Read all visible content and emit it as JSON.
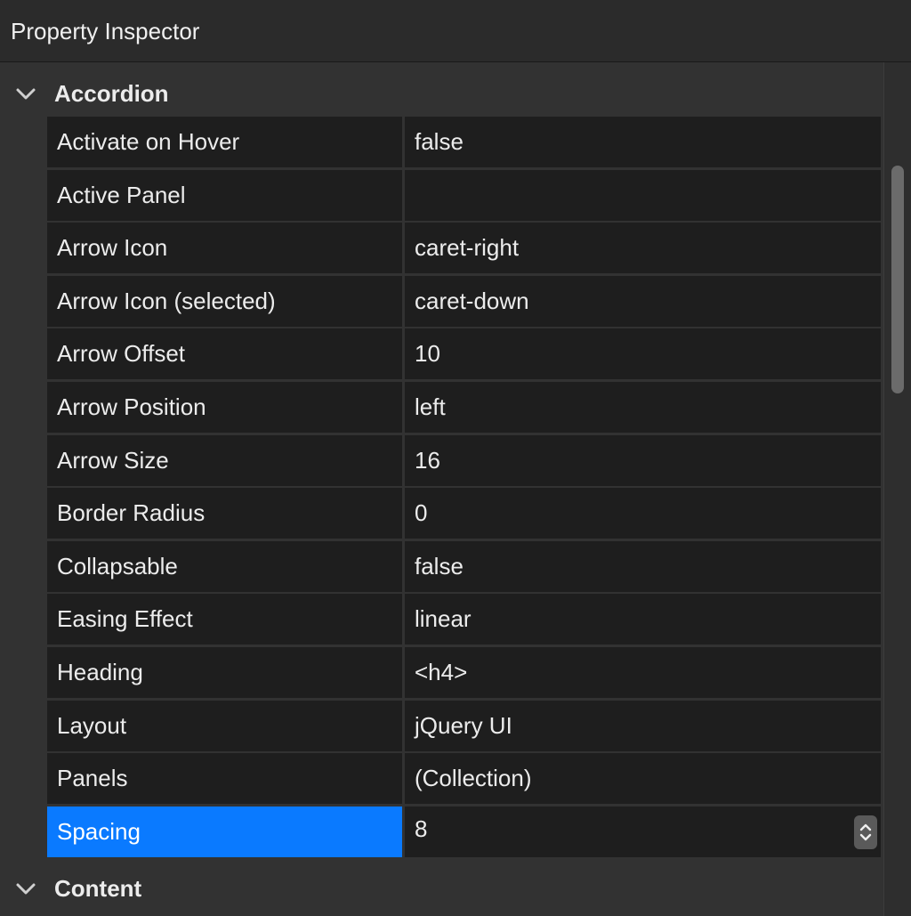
{
  "window": {
    "title": "Property Inspector"
  },
  "sections": [
    {
      "label": "Accordion",
      "expanded": true,
      "icon": "chevron-down-icon"
    },
    {
      "label": "Content",
      "expanded": true,
      "icon": "chevron-down-icon"
    }
  ],
  "properties": [
    {
      "name": "Activate on Hover",
      "value": "false"
    },
    {
      "name": "Active Panel",
      "value": ""
    },
    {
      "name": "Arrow Icon",
      "value": "caret-right"
    },
    {
      "name": "Arrow Icon (selected)",
      "value": "caret-down"
    },
    {
      "name": "Arrow Offset",
      "value": "10"
    },
    {
      "name": "Arrow Position",
      "value": "left"
    },
    {
      "name": "Arrow Size",
      "value": "16"
    },
    {
      "name": "Border Radius",
      "value": "0"
    },
    {
      "name": "Collapsable",
      "value": "false"
    },
    {
      "name": "Easing Effect",
      "value": "linear"
    },
    {
      "name": "Heading",
      "value": "<h4>"
    },
    {
      "name": "Layout",
      "value": "jQuery UI"
    },
    {
      "name": "Panels",
      "value": "(Collection)"
    },
    {
      "name": "Spacing",
      "value": "8",
      "selected": true,
      "editor": "stepper"
    }
  ],
  "colors": {
    "selection": "#0a7aff",
    "cell_background": "#1e1e1e",
    "panel_background": "#323232"
  }
}
